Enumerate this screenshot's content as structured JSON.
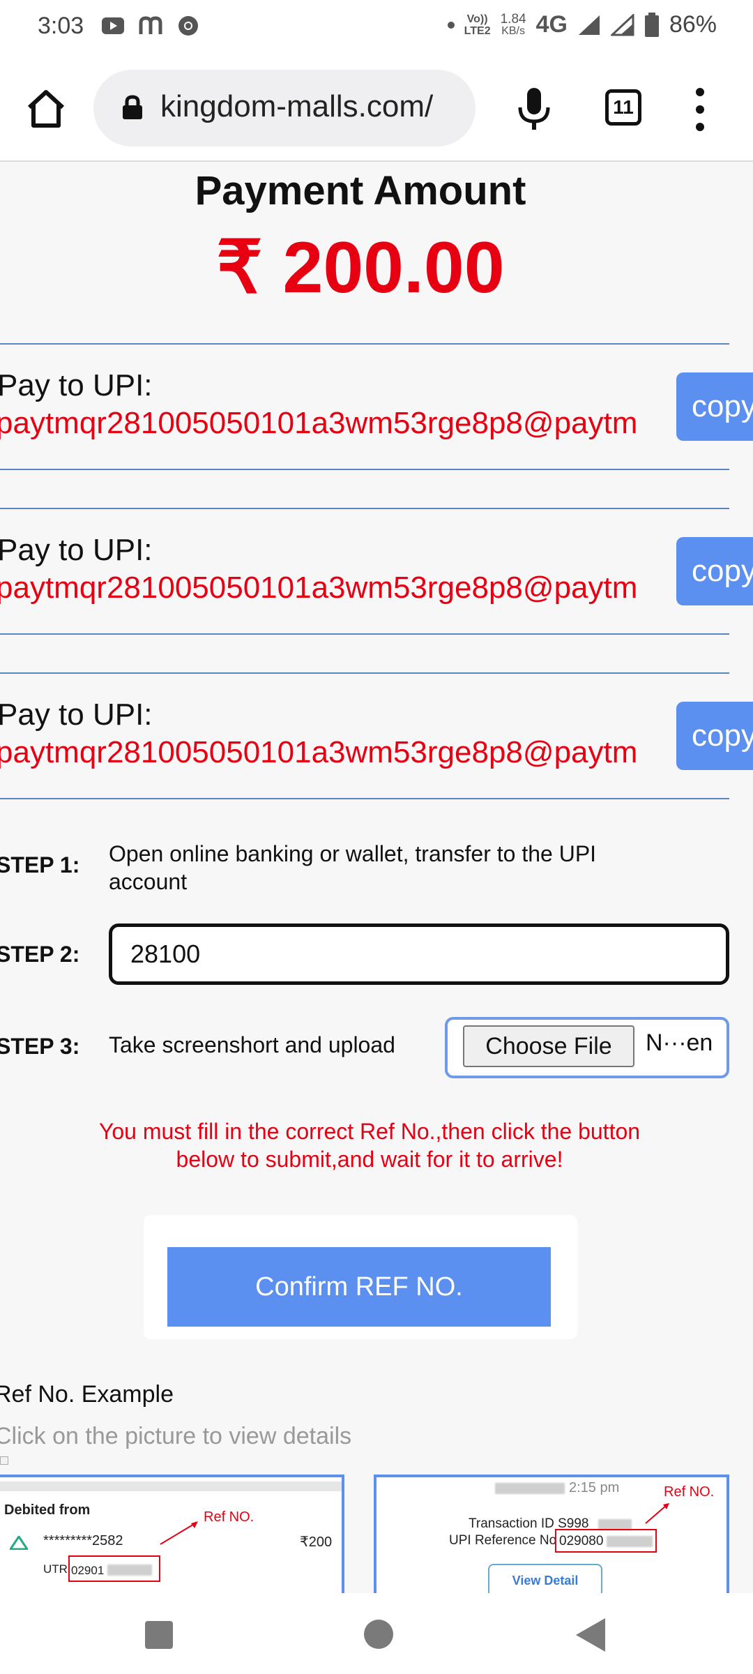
{
  "status_bar": {
    "time": "3:03",
    "network_top": "Vo))",
    "network_bottom": "LTE2",
    "speed_value": "1.84",
    "speed_unit": "KB/s",
    "network_type": "4G",
    "battery": "86%"
  },
  "browser": {
    "url": "kingdom-malls.com/",
    "tab_count": "11"
  },
  "payment": {
    "title": "Payment Amount",
    "amount": "₹ 200.00"
  },
  "upi_blocks": [
    {
      "label": "Pay to UPI:",
      "value": "paytmqr281005050101a3wm53rge8p8@paytm",
      "copy_label": "copy"
    },
    {
      "label": "Pay to UPI:",
      "value": "paytmqr281005050101a3wm53rge8p8@paytm",
      "copy_label": "copy"
    },
    {
      "label": "Pay to UPI:",
      "value": "paytmqr281005050101a3wm53rge8p8@paytm",
      "copy_label": "copy"
    }
  ],
  "steps": {
    "step1_label": "STEP 1:",
    "step1_text": "Open online banking or wallet, transfer to the UPI account",
    "step2_label": "STEP 2:",
    "step2_value": "28100",
    "step3_label": "STEP 3:",
    "step3_text": "Take screenshort and upload",
    "choose_file_label": "Choose File",
    "file_status": "N···en"
  },
  "warning": "You must fill in the correct Ref No.,then click the button below to submit,and wait for it to arrive!",
  "confirm_button": "Confirm REF NO.",
  "ref_example": {
    "title": "Ref No. Example",
    "hint": "Click on the picture to view details",
    "example1": {
      "debited_from": "Debited from",
      "account": "*********2582",
      "amount": "₹200",
      "utr_label": "UTR",
      "utr_value": "02901",
      "ref_label": "Ref NO."
    },
    "example2": {
      "time": "2:15 pm",
      "transaction_id": "Transaction ID S998",
      "upi_ref_label": "UPI Reference No",
      "upi_ref_value": "029080",
      "ref_label": "Ref NO.",
      "view_detail": "View Detail"
    }
  }
}
